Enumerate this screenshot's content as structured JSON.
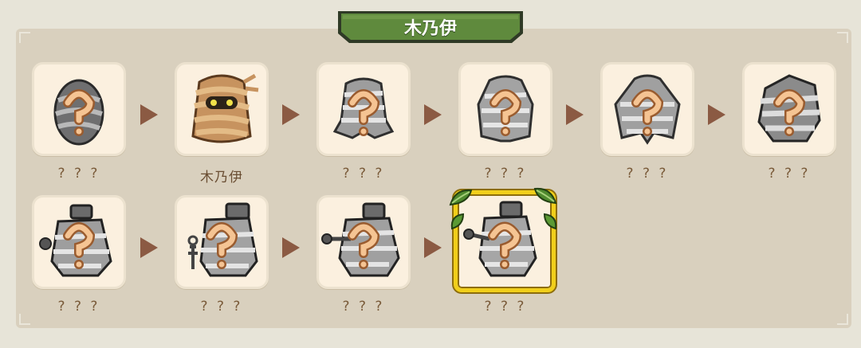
{
  "title": "木乃伊",
  "rows": [
    {
      "stages": [
        {
          "label": "? ? ?",
          "icon": "egg-silhouette-icon",
          "known": false
        },
        {
          "label": "木乃伊",
          "icon": "mummy-icon",
          "known": true
        },
        {
          "label": "? ? ?",
          "icon": "bandaged-creature-icon",
          "known": false
        },
        {
          "label": "? ? ?",
          "icon": "bandaged-creature-icon",
          "known": false
        },
        {
          "label": "? ? ?",
          "icon": "bandaged-creature-icon",
          "known": false
        },
        {
          "label": "? ? ?",
          "icon": "stone-creature-icon",
          "known": false
        }
      ]
    },
    {
      "stages": [
        {
          "label": "? ? ?",
          "icon": "pillar-mummy-icon",
          "known": false
        },
        {
          "label": "? ? ?",
          "icon": "pillar-mummy-icon",
          "known": false
        },
        {
          "label": "? ? ?",
          "icon": "pillar-mummy-icon",
          "known": false
        },
        {
          "label": "? ? ?",
          "icon": "pillar-mummy-icon",
          "known": false,
          "final": true
        }
      ]
    }
  ],
  "colors": {
    "banner": "#5f8a3d",
    "card": "#fbf0df",
    "arrow": "#8b5a43",
    "final_frame": "#f1cf1b",
    "question": "#f2b883"
  }
}
